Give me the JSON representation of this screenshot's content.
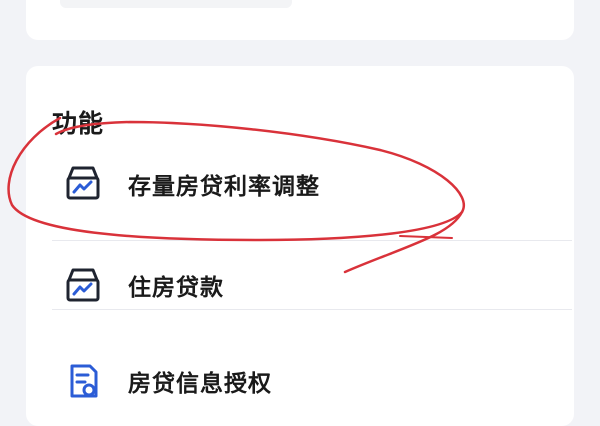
{
  "section": {
    "title": "功能"
  },
  "items": [
    {
      "label": "存量房贷利率调整",
      "icon": "house-loan-icon"
    },
    {
      "label": "住房贷款",
      "icon": "house-loan-icon"
    },
    {
      "label": "房贷信息授权",
      "icon": "document-authorization-icon"
    }
  ],
  "colors": {
    "icon_stroke": "#1f2430",
    "icon_accent": "#2b5cd6",
    "annotation": "#d9323a"
  }
}
